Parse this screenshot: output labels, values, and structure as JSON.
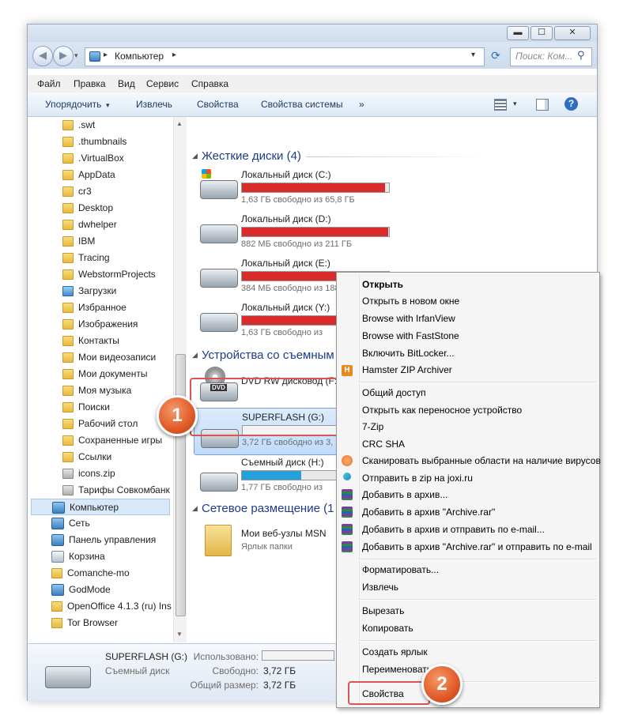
{
  "window": {
    "minimize": "▬",
    "maximize": "☐",
    "close": "✕"
  },
  "address": {
    "computer": "Компьютер",
    "sep": "▸",
    "dropdown": "▾",
    "refresh": "⟳"
  },
  "search": {
    "placeholder": "Поиск: Ком..."
  },
  "menu": [
    "Файл",
    "Правка",
    "Вид",
    "Сервис",
    "Справка"
  ],
  "toolbar": {
    "organize": "Упорядочить",
    "organize_arrow": "▾",
    "eject": "Извлечь",
    "properties": "Свойства",
    "system_properties": "Свойства системы",
    "more": "»",
    "help": "?"
  },
  "nav": {
    "folders": [
      ".swt",
      ".thumbnails",
      ".VirtualBox",
      "AppData",
      "cr3",
      "Desktop",
      "dwhelper",
      "IBM",
      "Tracing",
      "WebstormProjects",
      "Загрузки",
      "Избранное",
      "Изображения",
      "Контакты",
      "Мои видеозаписи",
      "Мои документы",
      "Моя музыка",
      "Поиски",
      "Рабочий стол",
      "Сохраненные игры",
      "Ссылки",
      "icons.zip",
      "Тарифы Совкомбанк"
    ],
    "root": [
      "Компьютер",
      "Сеть",
      "Панель управления",
      "Корзина",
      "Comanche-mo",
      "GodMode",
      "OpenOffice 4.1.3 (ru) Ins",
      "Tor Browser"
    ]
  },
  "content": {
    "hard_disks": {
      "header": "Жесткие диски (4)",
      "drives": [
        {
          "name": "Локальный диск (C:)",
          "free": "1,63 ГБ свободно из 65,8 ГБ",
          "used_fraction": 0.975
        },
        {
          "name": "Локальный диск (D:)",
          "free": "882 МБ свободно из 211 ГБ",
          "used_fraction": 0.996
        },
        {
          "name": "Локальный диск (E:)",
          "free": "384 МБ свободно из 188 ГБ",
          "used_fraction": 0.998
        },
        {
          "name": "Локальный диск (Y:)",
          "free": "1,63 ГБ свободно из",
          "used_fraction": 0.97
        }
      ]
    },
    "removable": {
      "header": "Устройства со съемным",
      "dvd": {
        "name": "DVD RW дисковод (F:)",
        "label": "DVD"
      },
      "flash": {
        "name": "SUPERFLASH (G:)",
        "free": "3,72 ГБ свободно из 3,",
        "used_fraction": 0.0
      },
      "removable_h": {
        "name": "Съемный диск (H:)",
        "free": "1,77 ГБ свободно из",
        "used_fraction": 0.5
      }
    },
    "network": {
      "header": "Сетевое размещение (1",
      "item": {
        "name": "Мои веб-узлы MSN",
        "sub": "Ярлык папки"
      }
    }
  },
  "details": {
    "name": "SUPERFLASH (G:)",
    "type": "Съемный диск",
    "used_label": "Использовано:",
    "free_label": "Свободно:",
    "free_value": "3,72 ГБ",
    "total_label": "Общий размер:",
    "total_value": "3,72 ГБ"
  },
  "context_menu": {
    "group1": [
      "Открыть",
      "Открыть в новом окне",
      "Browse with IrfanView",
      "Browse with FastStone",
      "Включить BitLocker...",
      "Hamster ZIP Archiver"
    ],
    "group2": [
      "Общий доступ",
      "Открыть как переносное устройство",
      "7-Zip",
      "CRC SHA",
      "Сканировать выбранные области на наличие вирусов",
      "Отправить в zip на joxi.ru",
      "Добавить в архив...",
      "Добавить в архив \"Archive.rar\"",
      "Добавить в архив и отправить по e-mail...",
      "Добавить в архив \"Archive.rar\" и отправить по e-mail"
    ],
    "group3": [
      "Форматировать...",
      "Извлечь"
    ],
    "group4": [
      "Вырезать",
      "Копировать"
    ],
    "group5": [
      "Создать ярлык",
      "Переименовать"
    ],
    "group6": [
      "Свойства"
    ],
    "hamster_icon": "H"
  },
  "annotations": {
    "badge1": "1",
    "badge2": "2"
  },
  "colors": {
    "bar_full": "#d92b2b",
    "bar_normal": "#26a0da",
    "accent": "#1e3b8a",
    "badge": "#e05a28",
    "highlight_box": "#d95555"
  }
}
